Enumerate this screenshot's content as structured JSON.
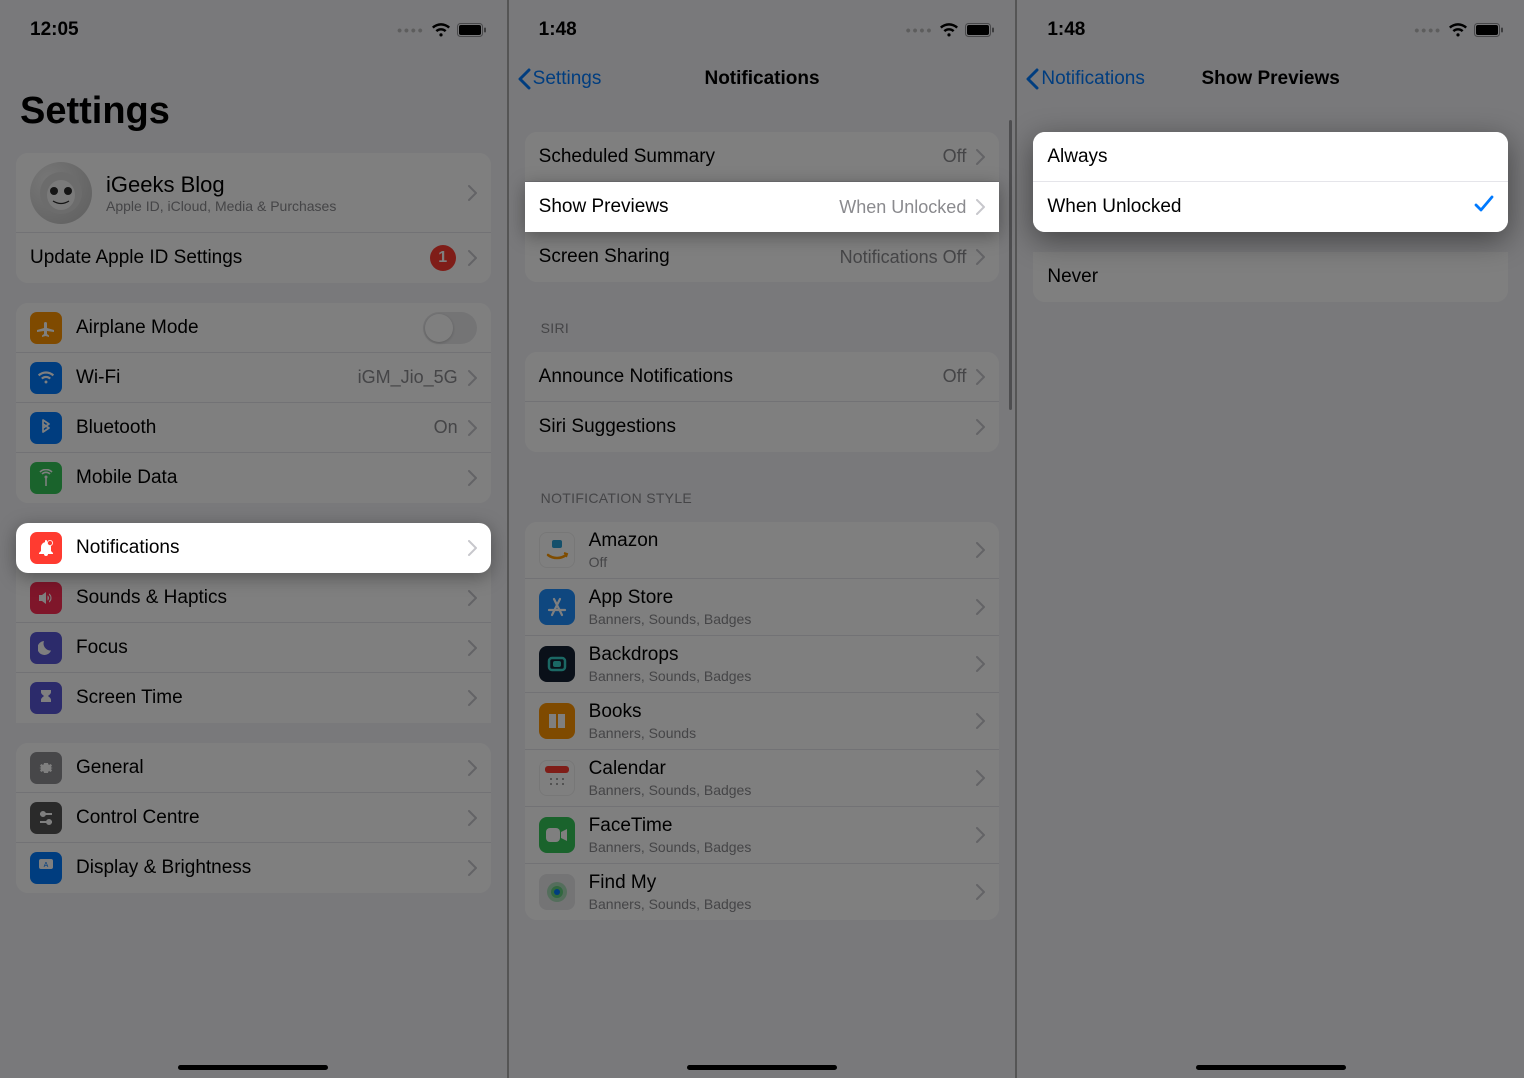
{
  "screen1": {
    "time": "12:05",
    "title": "Settings",
    "profile": {
      "name": "iGeeks Blog",
      "sub": "Apple ID, iCloud, Media & Purchases"
    },
    "appleid_row": {
      "label": "Update Apple ID Settings",
      "badge": "1"
    },
    "section1": [
      {
        "label": "Airplane Mode",
        "type": "toggle"
      },
      {
        "label": "Wi-Fi",
        "detail": "iGM_Jio_5G"
      },
      {
        "label": "Bluetooth",
        "detail": "On"
      },
      {
        "label": "Mobile Data"
      }
    ],
    "section2": [
      {
        "label": "Notifications",
        "highlight": true
      },
      {
        "label": "Sounds & Haptics"
      },
      {
        "label": "Focus"
      },
      {
        "label": "Screen Time"
      }
    ],
    "section3": [
      {
        "label": "General"
      },
      {
        "label": "Control Centre"
      },
      {
        "label": "Display & Brightness"
      }
    ]
  },
  "screen2": {
    "time": "1:48",
    "back": "Settings",
    "title": "Notifications",
    "section1": [
      {
        "label": "Scheduled Summary",
        "detail": "Off"
      },
      {
        "label": "Show Previews",
        "detail": "When Unlocked",
        "highlight": true
      },
      {
        "label": "Screen Sharing",
        "detail": "Notifications Off"
      }
    ],
    "siri_header": "SIRI",
    "section_siri": [
      {
        "label": "Announce Notifications",
        "detail": "Off"
      },
      {
        "label": "Siri Suggestions"
      }
    ],
    "style_header": "NOTIFICATION STYLE",
    "apps": [
      {
        "name": "Amazon",
        "sub": "Off"
      },
      {
        "name": "App Store",
        "sub": "Banners, Sounds, Badges"
      },
      {
        "name": "Backdrops",
        "sub": "Banners, Sounds, Badges"
      },
      {
        "name": "Books",
        "sub": "Banners, Sounds"
      },
      {
        "name": "Calendar",
        "sub": "Banners, Sounds, Badges"
      },
      {
        "name": "FaceTime",
        "sub": "Banners, Sounds, Badges"
      },
      {
        "name": "Find My",
        "sub": "Banners, Sounds, Badges"
      }
    ]
  },
  "screen3": {
    "time": "1:48",
    "back": "Notifications",
    "title": "Show Previews",
    "options": [
      {
        "label": "Always",
        "checked": false
      },
      {
        "label": "When Unlocked",
        "checked": true
      },
      {
        "label": "Never",
        "checked": false
      }
    ]
  }
}
